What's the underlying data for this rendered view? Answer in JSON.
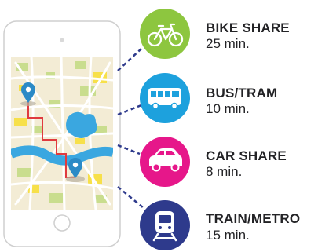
{
  "options": [
    {
      "title": "BIKE SHARE",
      "time": "25 min.",
      "color": "#8dc63f",
      "icon": "bicycle-icon"
    },
    {
      "title": "BUS/TRAM",
      "time": "10 min.",
      "color": "#1da1dd",
      "icon": "bus-icon"
    },
    {
      "title": "CAR SHARE",
      "time": "8 min.",
      "color": "#e6178a",
      "icon": "car-icon"
    },
    {
      "title": "TRAIN/METRO",
      "time": "15 min.",
      "color": "#2e3a8c",
      "icon": "train-icon"
    }
  ],
  "colors": {
    "route": "#e03a3e",
    "pin": "#2b8ac6",
    "river": "#3aa7e0",
    "map_bg": "#f3ecd5",
    "park": "#c9dd8e",
    "block_yellow": "#f7e04a"
  }
}
